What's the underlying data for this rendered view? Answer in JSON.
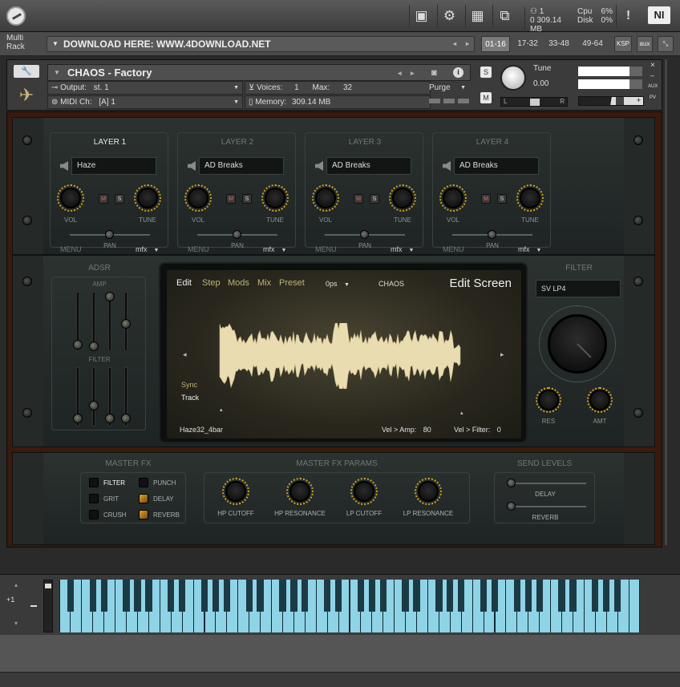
{
  "topbar": {
    "midi_in": "1",
    "midi_out": "0",
    "memory": "309.14 MB",
    "cpu_label": "Cpu",
    "cpu_value": "6%",
    "disk_label": "Disk",
    "disk_value": "0%",
    "warn": "!",
    "ni_logo": "NI"
  },
  "rack": {
    "title_line1": "Multi",
    "title_line2": "Rack",
    "download_text": "DOWNLOAD HERE: WWW.4DOWNLOAD.NET",
    "ranges": [
      "01-16",
      "17-32",
      "33-48",
      "49-64"
    ],
    "ksp": "KSP",
    "aux": "aux"
  },
  "instrument": {
    "name": "CHAOS - Factory",
    "output_label": "Output:",
    "output_value": "st. 1",
    "voices_label": "Voices:",
    "voices_value": "1",
    "max_label": "Max:",
    "max_value": "32",
    "midi_label": "MIDI Ch:",
    "midi_value": "[A]  1",
    "memory_label": "Memory:",
    "memory_value": "309.14 MB",
    "purge": "Purge",
    "s_btn": "S",
    "m_btn": "M",
    "tune_label": "Tune",
    "tune_value": "0.00",
    "pan_l": "L",
    "pan_r": "R",
    "aux_label": "AUX",
    "pv_label": "PV",
    "close": "×",
    "min": "–",
    "minus": "–",
    "plus": "+"
  },
  "layers": [
    {
      "title": "LAYER 1",
      "name": "Haze",
      "active": true
    },
    {
      "title": "LAYER 2",
      "name": "AD Breaks",
      "active": false
    },
    {
      "title": "LAYER 3",
      "name": "AD Breaks",
      "active": false
    },
    {
      "title": "LAYER 4",
      "name": "AD Breaks",
      "active": false
    }
  ],
  "layer_labels": {
    "vol": "VOL",
    "tune": "TUNE",
    "menu": "MENU",
    "pan": "PAN",
    "mfx": "mfx",
    "m": "M",
    "s": "S"
  },
  "adsr": {
    "title": "ADSR",
    "amp": "AMP",
    "filter": "FILTER"
  },
  "screen": {
    "tabs": [
      "Edit",
      "Step",
      "Mods",
      "Mix",
      "Preset"
    ],
    "ops": "0ps",
    "name": "CHAOS",
    "title": "Edit Screen",
    "sync": "Sync",
    "track": "Track",
    "sample": "Haze32_4bar",
    "vel_amp_label": "Vel > Amp:",
    "vel_amp_value": "80",
    "vel_filter_label": "Vel > Filter:",
    "vel_filter_value": "0"
  },
  "filter": {
    "title": "FILTER",
    "type": "SV LP4",
    "res": "RES",
    "amt": "AMT"
  },
  "master_fx": {
    "title": "MASTER FX",
    "items": [
      {
        "label": "FILTER",
        "on": false,
        "lit": true
      },
      {
        "label": "PUNCH",
        "on": false,
        "lit": false
      },
      {
        "label": "GRIT",
        "on": false,
        "lit": false
      },
      {
        "label": "DELAY",
        "on": true,
        "lit": false
      },
      {
        "label": "CRUSH",
        "on": false,
        "lit": false
      },
      {
        "label": "REVERB",
        "on": true,
        "lit": false
      }
    ]
  },
  "master_params": {
    "title": "MASTER FX PARAMS",
    "knobs": [
      "HP CUTOFF",
      "HP RESONANCE",
      "LP CUTOFF",
      "LP RESONANCE"
    ]
  },
  "send_levels": {
    "title": "SEND LEVELS",
    "delay": "DELAY",
    "reverb": "REVERB"
  },
  "keyboard": {
    "octave": "+1"
  },
  "colors": {
    "accent": "#d4a21a",
    "key_white": "#8fd3e6",
    "key_black": "#1c3a44"
  }
}
